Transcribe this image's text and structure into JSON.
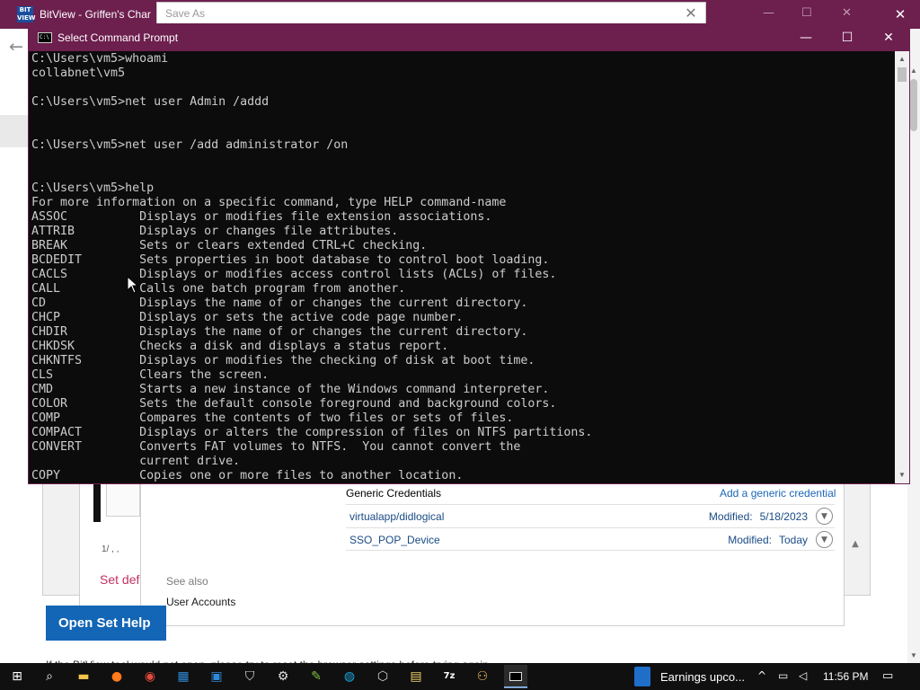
{
  "background_window": {
    "title": "BitView - Griffen's Chart",
    "app_icon_text": "BIT VIEW",
    "close_label": "✕",
    "back_icon": "←"
  },
  "save_as_dialog": {
    "title": "Save As",
    "close_label": "✕",
    "controls": [
      "—",
      "☐",
      "✕"
    ]
  },
  "cmd_window": {
    "title": "Select Command Prompt",
    "icon_text": "C:\\",
    "controls": {
      "minimize": "—",
      "maximize": "☐",
      "close": "✕"
    },
    "lines": [
      "C:\\Users\\vm5>whoami",
      "collabnet\\vm5",
      "",
      "C:\\Users\\vm5>net user Admin /addd",
      "",
      "",
      "C:\\Users\\vm5>net user /add administrator /on",
      "",
      "",
      "C:\\Users\\vm5>help",
      "For more information on a specific command, type HELP command-name",
      "ASSOC          Displays or modifies file extension associations.",
      "ATTRIB         Displays or changes file attributes.",
      "BREAK          Sets or clears extended CTRL+C checking.",
      "BCDEDIT        Sets properties in boot database to control boot loading.",
      "CACLS          Displays or modifies access control lists (ACLs) of files.",
      "CALL           Calls one batch program from another.",
      "CD             Displays the name of or changes the current directory.",
      "CHCP           Displays or sets the active code page number.",
      "CHDIR          Displays the name of or changes the current directory.",
      "CHKDSK         Checks a disk and displays a status report.",
      "CHKNTFS        Displays or modifies the checking of disk at boot time.",
      "CLS            Clears the screen.",
      "CMD            Starts a new instance of the Windows command interpreter.",
      "COLOR          Sets the default console foreground and background colors.",
      "COMP           Compares the contents of two files or sets of files.",
      "COMPACT        Displays or alters the compression of files on NTFS partitions.",
      "CONVERT        Converts FAT volumes to NTFS.  You cannot convert the",
      "               current drive.",
      "COPY           Copies one or more files to another location."
    ]
  },
  "credential_manager": {
    "section_title": "Generic Credentials",
    "add_link": "Add a generic credential",
    "items": [
      {
        "name": "virtualapp/didlogical",
        "modified_label": "Modified:",
        "modified_value": "5/18/2023"
      },
      {
        "name": "SSO_POP_Device",
        "modified_label": "Modified:",
        "modified_value": "Today"
      }
    ],
    "see_also": "See also",
    "user_accounts": "User Accounts",
    "set_default_partial": "Set def",
    "partial_date": "1/  ,  ,"
  },
  "bitview_page": {
    "open_button_partial": "Open Set Help",
    "footer_partial": "If the BitView tool would not open, please try to reset the browser settings before trying again"
  },
  "taskbar": {
    "news_text": "Earnings upco...",
    "time": "11:56 PM",
    "zip_label": "7z",
    "icons": [
      "windows-start-icon",
      "search-icon",
      "file-explorer-icon",
      "firefox-icon",
      "chrome-icon",
      "edge-icon",
      "settings-icon",
      "command-prompt-icon"
    ]
  },
  "colors": {
    "titlebar_accent": "#6d1f4e",
    "console_background": "#0c0c0c",
    "console_text": "#cccccc",
    "link_blue": "#1a66b8",
    "button_blue": "#1365b5"
  }
}
